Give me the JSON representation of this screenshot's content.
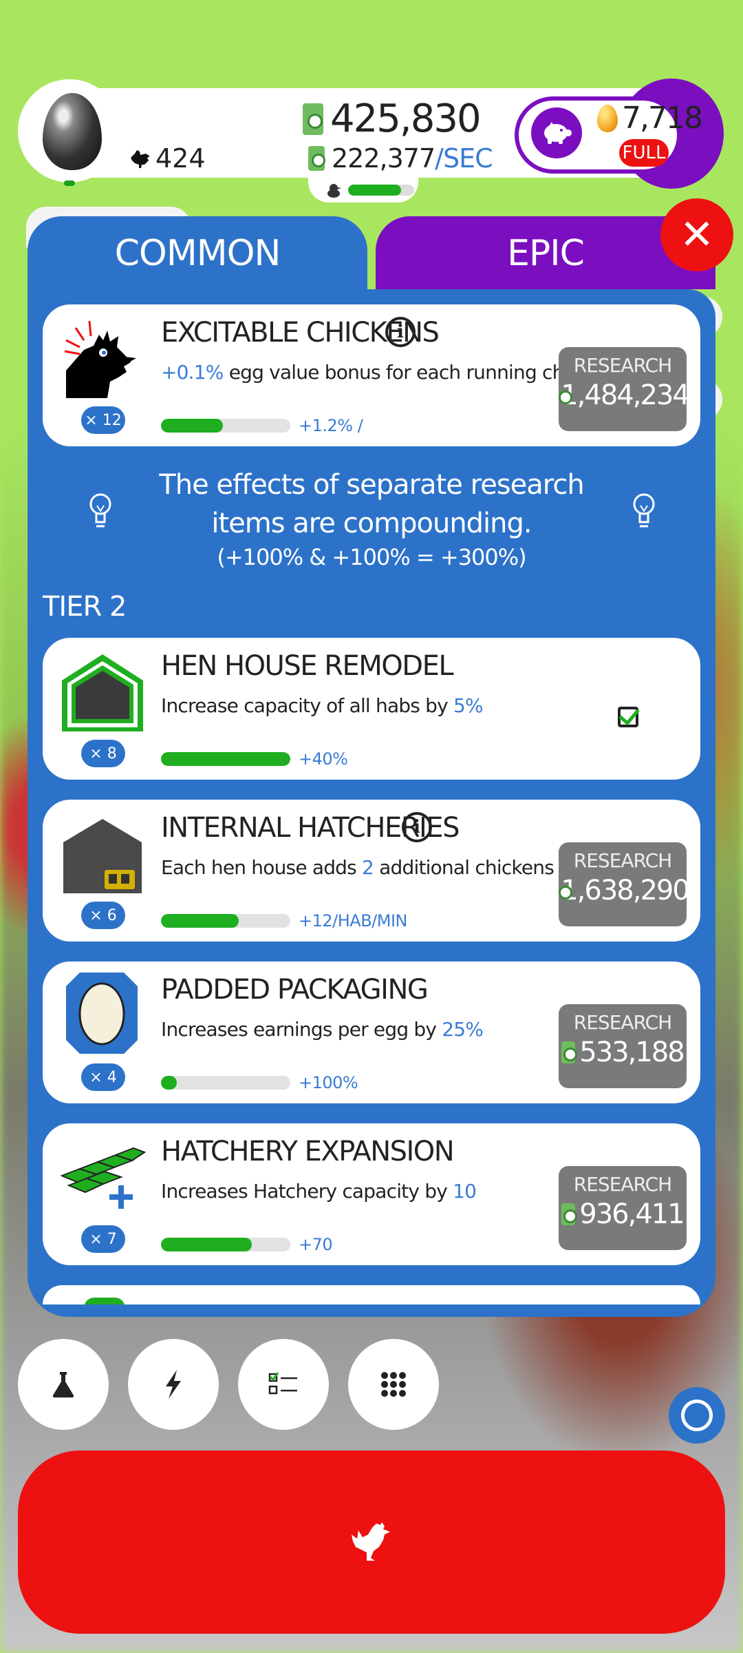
{
  "hud": {
    "chicken_count": "424",
    "cash_amount": "425,830",
    "cash_rate": "222,377",
    "cash_rate_unit": "/SEC",
    "hatch_progress": 0.8,
    "golden_eggs": "7,718",
    "silo_status": "FULL"
  },
  "tabs": {
    "common": "COMMON",
    "epic": "EPIC"
  },
  "research_items": [
    {
      "title": "EXCITABLE CHICKENS",
      "level": "× 12",
      "desc_highlight": "+0.1%",
      "desc_text": " egg value bonus for each running chicken",
      "progress": 0.48,
      "progress_value": "+1.2% /",
      "research_label": "RESEARCH",
      "price": "1,484,234"
    },
    {
      "title": "HEN HOUSE REMODEL",
      "level": "× 8",
      "desc_text": "Increase capacity of all habs by ",
      "desc_highlight": "5%",
      "progress": 1.0,
      "progress_value": "+40%",
      "completed": true
    },
    {
      "title": "INTERNAL HATCHERIES",
      "level": "× 6",
      "desc_text_a": "Each hen house adds ",
      "desc_highlight": "2",
      "desc_text_b": " additional chickens per minute",
      "progress": 0.6,
      "progress_value": "+12/HAB/MIN",
      "research_label": "RESEARCH",
      "price": "1,638,290"
    },
    {
      "title": "PADDED PACKAGING",
      "level": "× 4",
      "desc_text": "Increases earnings per egg by ",
      "desc_highlight": "25%",
      "progress": 0.12,
      "progress_value": "+100%",
      "research_label": "RESEARCH",
      "price": "533,188"
    },
    {
      "title": "HATCHERY EXPANSION",
      "level": "× 7",
      "desc_text": "Increases Hatchery capacity by ",
      "desc_highlight": "10",
      "progress": 0.7,
      "progress_value": "+70",
      "research_label": "RESEARCH",
      "price": "936,411"
    }
  ],
  "tip": {
    "text": "The effects of separate research items are compounding.",
    "formula": "(+100% & +100% = +300%)"
  },
  "tier_label": "TIER 2",
  "icons": {
    "research": "flask-icon",
    "boosts": "lightning-icon",
    "missions": "checklist-icon",
    "menu": "grid-icon",
    "hatch": "chicken-icon"
  },
  "colors": {
    "accent_blue": "#2d72c9",
    "epic_purple": "#7b0fc0",
    "hatch_red": "#ee1111",
    "progress_green": "#1fae1f"
  }
}
